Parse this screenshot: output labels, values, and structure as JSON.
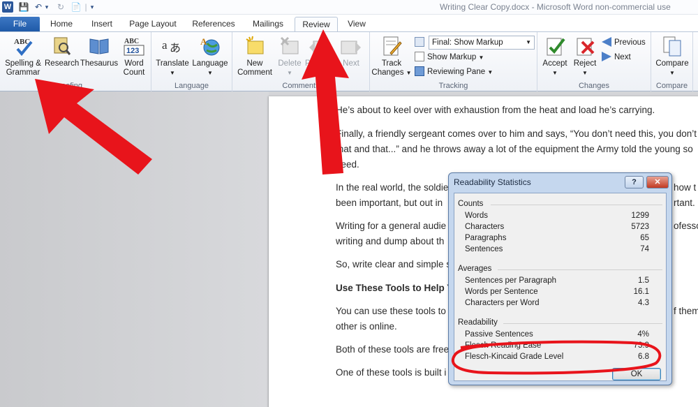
{
  "window": {
    "title": "Writing Clear Copy.docx  -  Microsoft Word non-commercial use",
    "app_letter": "W",
    "qat": [
      "💾",
      "↶",
      "▾",
      "↻",
      "📄",
      "|",
      "▾"
    ]
  },
  "tabs": [
    "File",
    "Home",
    "Insert",
    "Page Layout",
    "References",
    "Mailings",
    "Review",
    "View"
  ],
  "ribbon": {
    "proofing": {
      "spelling": "Spelling &",
      "spelling2": "Grammar",
      "research": "Research",
      "thesaurus": "Thesaurus",
      "word_count": "Word",
      "word_count2": "Count",
      "label": "Proofing",
      "label_visible": "oofing"
    },
    "language": {
      "translate": "Translate",
      "language": "Language",
      "label": "Language"
    },
    "comments": {
      "new_comment": "New",
      "new_comment2": "Comment",
      "delete": "Delete",
      "previous": "Previous",
      "previous_visible": "Prev",
      "next": "Next",
      "label": "Comments"
    },
    "tracking": {
      "track_changes": "Track",
      "track_changes2": "Changes",
      "markup_combo": "Final: Show Markup",
      "show_markup": "Show Markup",
      "reviewing_pane": "Reviewing Pane",
      "label": "Tracking"
    },
    "changes": {
      "accept": "Accept",
      "reject": "Reject",
      "previous": "Previous",
      "next": "Next",
      "label": "Changes"
    },
    "compare": {
      "compare": "Compare",
      "label": "Compare"
    }
  },
  "document": {
    "paragraphs": [
      "He’s about to keel over with exhaustion from the heat and load he’s carrying.",
      "Finally, a friendly sergeant comes over to him and says, “You don’t need this, you don’t",
      "that and that...” and he throws away a lot of the equipment the Army told the young so",
      "need.",
      "In the real world, the soldie",
      "been important, but out in",
      "Writing for a general audie",
      "writing and dump about th",
      "So, write clear and simple s",
      "Use These Tools to Help Yo",
      "You can use these tools to",
      "other is online.",
      "Both of these tools are free",
      " One of these tools is built i"
    ],
    "fragments_right": [
      "how t",
      "rtant.",
      "ofesso",
      "f them"
    ]
  },
  "dialog": {
    "title": "Readability Statistics",
    "help": "?",
    "close": "✕",
    "counts_label": "Counts",
    "counts": [
      {
        "label": "Words",
        "value": "1299"
      },
      {
        "label": "Characters",
        "value": "5723"
      },
      {
        "label": "Paragraphs",
        "value": "65"
      },
      {
        "label": "Sentences",
        "value": "74"
      }
    ],
    "averages_label": "Averages",
    "averages": [
      {
        "label": "Sentences per Paragraph",
        "value": "1.5"
      },
      {
        "label": "Words per Sentence",
        "value": "16.1"
      },
      {
        "label": "Characters per Word",
        "value": "4.3"
      }
    ],
    "readability_label": "Readability",
    "readability": [
      {
        "label": "Passive Sentences",
        "value": "4%"
      },
      {
        "label": "Flesch Reading Ease",
        "value": "73.9"
      },
      {
        "label": "Flesch-Kincaid Grade Level",
        "value": "6.8"
      }
    ],
    "ok": "OK"
  },
  "colors": {
    "file_tab": "#2b579a",
    "annotation": "#e8141b",
    "dialog_frame": "#c5d7ee"
  }
}
